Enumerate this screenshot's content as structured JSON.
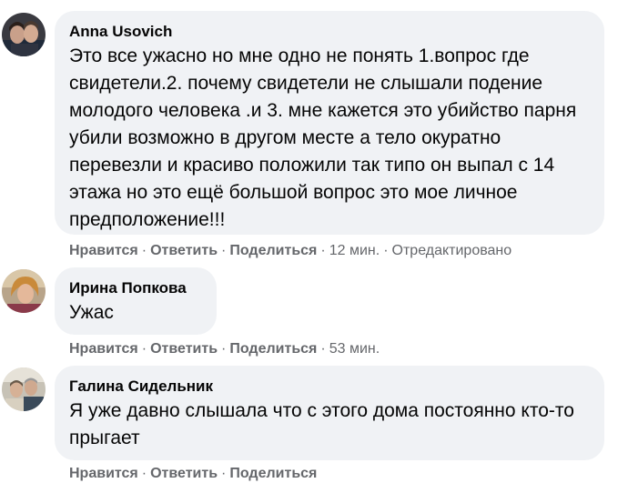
{
  "comments": [
    {
      "author": "Anna Usovich",
      "text": "Это все ужасно но мне одно не понять 1.вопрос где свидетели.2. почему свидетели не слышали подение молодого человека .и 3. мне кажется это убийство парня убили возможно в другом месте а тело окуратно перевезли и красиво положили так типо он выпал с 14 этажа но это ещё большой вопрос это мое личное предположение!!!",
      "like": "Нравится",
      "reply": "Ответить",
      "share": "Поделиться",
      "time": "12 мин.",
      "edited": "Отредактировано"
    },
    {
      "author": "Ирина Попкова",
      "text": "Ужас",
      "like": "Нравится",
      "reply": "Ответить",
      "share": "Поделиться",
      "time": "53 мин."
    },
    {
      "author": "Галина Сидельник",
      "text": "Я уже давно слышала что с этого дома постоянно кто-то прыгает",
      "like": "Нравится",
      "reply": "Ответить",
      "share": "Поделиться"
    }
  ],
  "separator": "·",
  "colors": {
    "bubble_bg": "#f0f2f5",
    "text": "#050505",
    "secondary": "#65676b"
  },
  "icons": {
    "avatar": "avatar-photo-icon"
  }
}
